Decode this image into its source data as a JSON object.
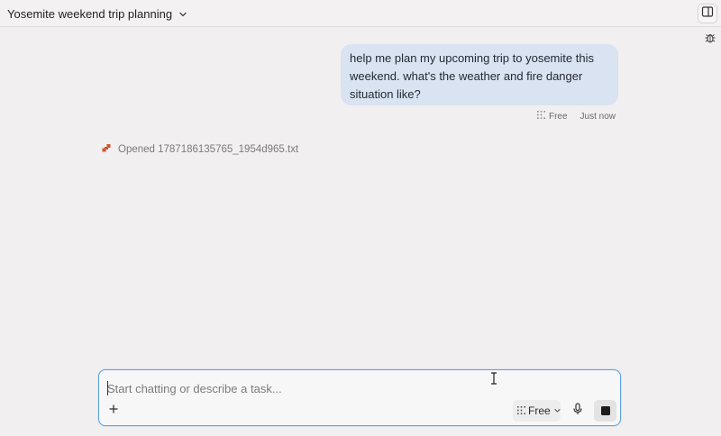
{
  "header": {
    "title": "Yosemite weekend trip planning",
    "title_menu_icon": "chevron-down-icon",
    "panel_icon": "sidebar-panel-icon",
    "debug_icon": "bug-icon"
  },
  "conversation": {
    "user_message": {
      "text": "help me plan my upcoming trip to yosemite this weekend. what's the weather and fire danger situation like?",
      "model_icon": "model-grid-icon",
      "model": "Free",
      "timestamp": "Just now"
    },
    "activity": {
      "icon": "tool-activity-icon",
      "text": "Opened 1787186135765_1954d965.txt"
    }
  },
  "composer": {
    "placeholder": "Start chatting or describe a task...",
    "value": "",
    "add_icon": "plus-icon",
    "model_select": {
      "icon": "model-grid-icon",
      "value": "Free",
      "chevron_icon": "chevron-down-icon"
    },
    "mic_icon": "microphone-icon",
    "stop_icon": "stop-icon"
  },
  "colors": {
    "background": "#f1eff0",
    "user_bubble": "#d9e3f1",
    "composer_border": "#5ea3e0",
    "activity_icon": "#d2552b"
  }
}
